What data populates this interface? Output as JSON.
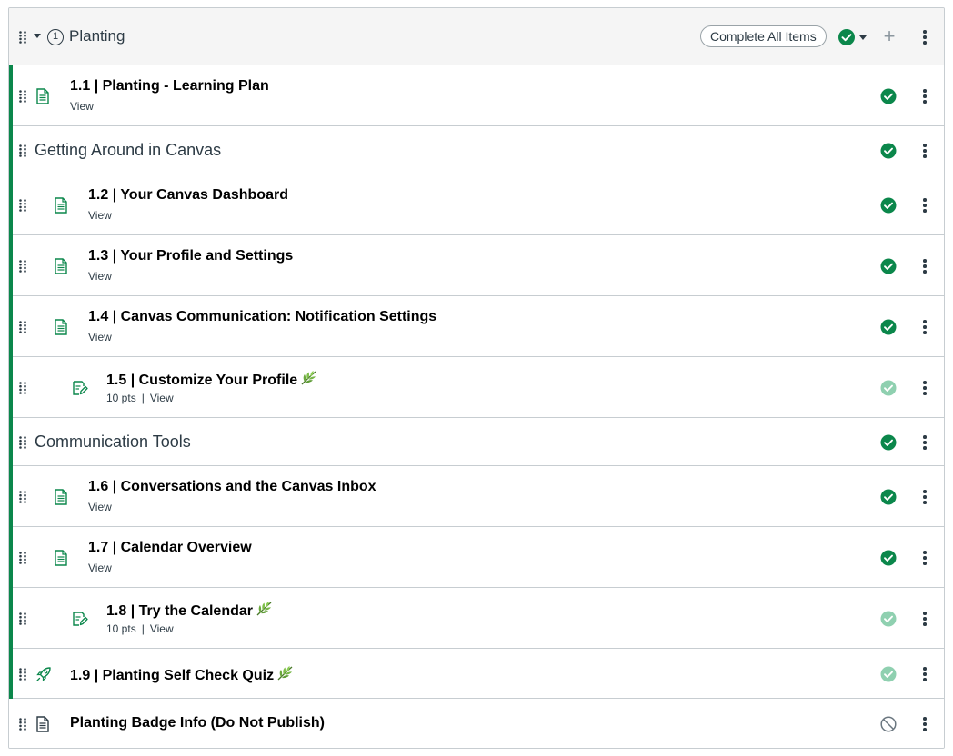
{
  "module": {
    "requirement_number": "1",
    "title": "Planting",
    "complete_all_label": "Complete All Items",
    "publish_status": "published",
    "add_icon": "plus-icon",
    "menu_icon": "kebab-icon"
  },
  "colors": {
    "published_green": "#0b874b",
    "published_light": "#8fd0b0",
    "accent_border": "#0b874b",
    "unpublished_gray": "#6b7780"
  },
  "items": [
    {
      "type": "page",
      "indent": 0,
      "title": "1.1 | Planting - Learning Plan",
      "meta": [
        "View"
      ],
      "status": "published",
      "leaf": false
    },
    {
      "type": "subheader",
      "indent": 0,
      "title": "Getting Around in Canvas",
      "meta": [],
      "status": "published",
      "leaf": false
    },
    {
      "type": "page",
      "indent": 1,
      "title": "1.2 | Your Canvas Dashboard",
      "meta": [
        "View"
      ],
      "status": "published",
      "leaf": false
    },
    {
      "type": "page",
      "indent": 1,
      "title": "1.3 | Your Profile and Settings",
      "meta": [
        "View"
      ],
      "status": "published",
      "leaf": false
    },
    {
      "type": "page",
      "indent": 1,
      "title": "1.4 | Canvas Communication: Notification Settings",
      "meta": [
        "View"
      ],
      "status": "published",
      "leaf": false
    },
    {
      "type": "assignment",
      "indent": 2,
      "title": "1.5 | Customize Your Profile",
      "meta": [
        "10 pts",
        "View"
      ],
      "status": "published-light",
      "leaf": true
    },
    {
      "type": "subheader",
      "indent": 0,
      "title": "Communication Tools",
      "meta": [],
      "status": "published",
      "leaf": false
    },
    {
      "type": "page",
      "indent": 1,
      "title": "1.6 | Conversations and the Canvas Inbox",
      "meta": [
        "View"
      ],
      "status": "published",
      "leaf": false
    },
    {
      "type": "page",
      "indent": 1,
      "title": "1.7 | Calendar Overview",
      "meta": [
        "View"
      ],
      "status": "published",
      "leaf": false
    },
    {
      "type": "assignment",
      "indent": 2,
      "title": "1.8 | Try the Calendar",
      "meta": [
        "10 pts",
        "View"
      ],
      "status": "published-light",
      "leaf": true
    },
    {
      "type": "quiz",
      "indent": 0,
      "title": "1.9 | Planting Self Check Quiz",
      "meta": [],
      "status": "published-light",
      "leaf": true
    },
    {
      "type": "page-unpublished",
      "indent": 0,
      "title": "Planting Badge Info (Do Not Publish)",
      "meta": [],
      "status": "unpublished",
      "leaf": false
    }
  ],
  "separator": "|"
}
